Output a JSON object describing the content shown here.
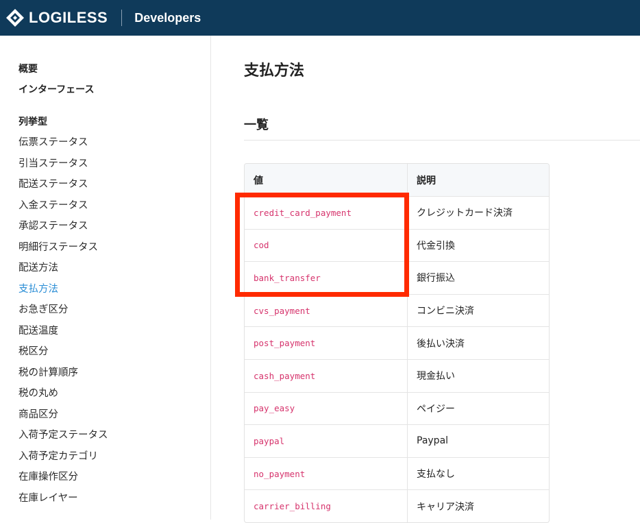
{
  "header": {
    "brand": "LOGILESS",
    "subtitle": "Developers"
  },
  "sidebar": {
    "group1": [
      {
        "label": "概要",
        "bold": true
      },
      {
        "label": "インターフェース",
        "bold": true
      }
    ],
    "group2_title": "列挙型",
    "items": [
      {
        "label": "伝票ステータス"
      },
      {
        "label": "引当ステータス"
      },
      {
        "label": "配送ステータス"
      },
      {
        "label": "入金ステータス"
      },
      {
        "label": "承認ステータス"
      },
      {
        "label": "明細行ステータス"
      },
      {
        "label": "配送方法"
      },
      {
        "label": "支払方法",
        "active": true
      },
      {
        "label": "お急ぎ区分"
      },
      {
        "label": "配送温度"
      },
      {
        "label": "税区分"
      },
      {
        "label": "税の計算順序"
      },
      {
        "label": "税の丸め"
      },
      {
        "label": "商品区分"
      },
      {
        "label": "入荷予定ステータス"
      },
      {
        "label": "入荷予定カテゴリ"
      },
      {
        "label": "在庫操作区分"
      },
      {
        "label": "在庫レイヤー"
      }
    ]
  },
  "main": {
    "title": "支払方法",
    "section": "一覧",
    "table": {
      "headers": [
        "値",
        "説明"
      ],
      "rows": [
        {
          "value": "credit_card_payment",
          "desc": "クレジットカード決済"
        },
        {
          "value": "cod",
          "desc": "代金引換"
        },
        {
          "value": "bank_transfer",
          "desc": "銀行振込"
        },
        {
          "value": "cvs_payment",
          "desc": "コンビニ決済"
        },
        {
          "value": "post_payment",
          "desc": "後払い決済"
        },
        {
          "value": "cash_payment",
          "desc": "現金払い"
        },
        {
          "value": "pay_easy",
          "desc": "ペイジー"
        },
        {
          "value": "paypal",
          "desc": "Paypal"
        },
        {
          "value": "no_payment",
          "desc": "支払なし"
        },
        {
          "value": "carrier_billing",
          "desc": "キャリア決済"
        }
      ]
    }
  },
  "colors": {
    "header_bg": "#0f3a5a",
    "active_link": "#2b8ed6",
    "code_text": "#d6336c",
    "highlight": "#ff2a00"
  }
}
